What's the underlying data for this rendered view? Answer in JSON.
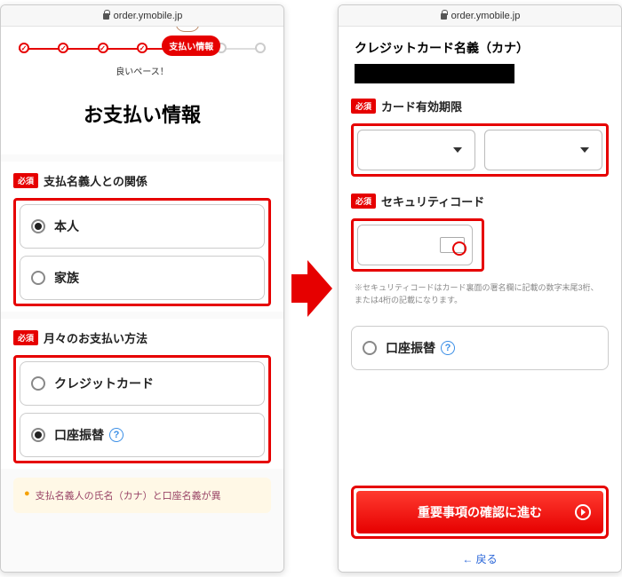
{
  "url": "order.ymobile.jp",
  "progress": {
    "active_label": "支払い情報",
    "caption": "良いペース！"
  },
  "page_title": "お支払い情報",
  "required_badge": "必須",
  "sections": {
    "relation": {
      "title": "支払名義人との関係",
      "options": [
        "本人",
        "家族"
      ]
    },
    "method": {
      "title": "月々のお支払い方法",
      "options": [
        "クレジットカード",
        "口座振替"
      ]
    }
  },
  "notice": "支払名義人の氏名（カナ）と口座名義が異",
  "right": {
    "cardholder_label": "クレジットカード名義（カナ）",
    "expiry_label": "カード有効期限",
    "security_label": "セキュリティコード",
    "security_hint": "※セキュリティコードはカード裏面の署名欄に記載の数字末尾3桁、または4桁の記載になります。",
    "bank_option": "口座振替",
    "primary_button": "重要事項の確認に進む",
    "back_link": "戻る"
  }
}
